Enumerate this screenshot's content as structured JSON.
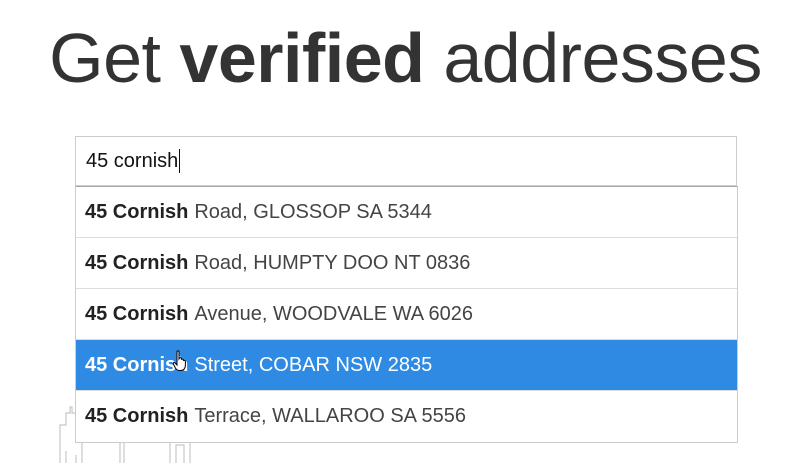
{
  "headline": {
    "prefix": "Get",
    "bold": "verified",
    "suffix": "addresses"
  },
  "search": {
    "value": "45 cornish"
  },
  "suggestions": [
    {
      "match": "45 Cornish",
      "rest": "Road, GLOSSOP SA 5344",
      "active": false
    },
    {
      "match": "45 Cornish",
      "rest": "Road, HUMPTY DOO NT 0836",
      "active": false
    },
    {
      "match": "45 Cornish",
      "rest": "Avenue, WOODVALE WA 6026",
      "active": false
    },
    {
      "match": "45 Cornish",
      "rest": "Street, COBAR NSW 2835",
      "active": true
    },
    {
      "match": "45 Cornish",
      "rest": "Terrace, WALLAROO SA 5556",
      "active": false
    }
  ],
  "colors": {
    "highlight": "#2f8ae3",
    "headline_text": "#333333",
    "border": "#cccccc"
  },
  "icons": {
    "pointer": "hand-pointer-icon",
    "decoration": "city-skyline-outline"
  }
}
